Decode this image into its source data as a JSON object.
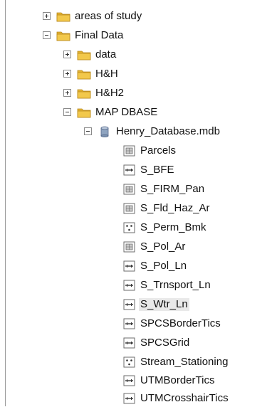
{
  "tree": {
    "items": [
      {
        "label": "areas of study",
        "state": "collapsed",
        "icon": "folder-icon"
      },
      {
        "label": "Final Data",
        "state": "expanded",
        "icon": "folder-icon"
      },
      {
        "label": "data",
        "state": "collapsed",
        "icon": "folder-icon"
      },
      {
        "label": "H&H",
        "state": "collapsed",
        "icon": "folder-icon"
      },
      {
        "label": "H&H2",
        "state": "collapsed",
        "icon": "folder-icon"
      },
      {
        "label": "MAP DBASE",
        "state": "expanded",
        "icon": "folder-icon"
      },
      {
        "label": "Henry_Database.mdb",
        "state": "expanded",
        "icon": "database-icon"
      },
      {
        "label": "Parcels",
        "icon": "polygon-feature-class-icon"
      },
      {
        "label": "S_BFE",
        "icon": "line-feature-class-icon"
      },
      {
        "label": "S_FIRM_Pan",
        "icon": "polygon-feature-class-icon"
      },
      {
        "label": "S_Fld_Haz_Ar",
        "icon": "polygon-feature-class-icon"
      },
      {
        "label": "S_Perm_Bmk",
        "icon": "point-feature-class-icon"
      },
      {
        "label": "S_Pol_Ar",
        "icon": "polygon-feature-class-icon"
      },
      {
        "label": "S_Pol_Ln",
        "icon": "line-feature-class-icon"
      },
      {
        "label": "S_Trnsport_Ln",
        "icon": "line-feature-class-icon"
      },
      {
        "label": "S_Wtr_Ln",
        "icon": "line-feature-class-icon",
        "selected": true
      },
      {
        "label": "SPCSBorderTics",
        "icon": "line-feature-class-icon"
      },
      {
        "label": "SPCSGrid",
        "icon": "line-feature-class-icon"
      },
      {
        "label": "Stream_Stationing",
        "icon": "point-feature-class-icon"
      },
      {
        "label": "UTMBorderTics",
        "icon": "line-feature-class-icon"
      },
      {
        "label": "UTMCrosshairTics",
        "icon": "line-feature-class-icon"
      }
    ]
  },
  "colors": {
    "folder_body": "#f2c84b",
    "folder_tab": "#e3b232",
    "database": "#7d93b1",
    "selection": "#e9e9e9"
  }
}
